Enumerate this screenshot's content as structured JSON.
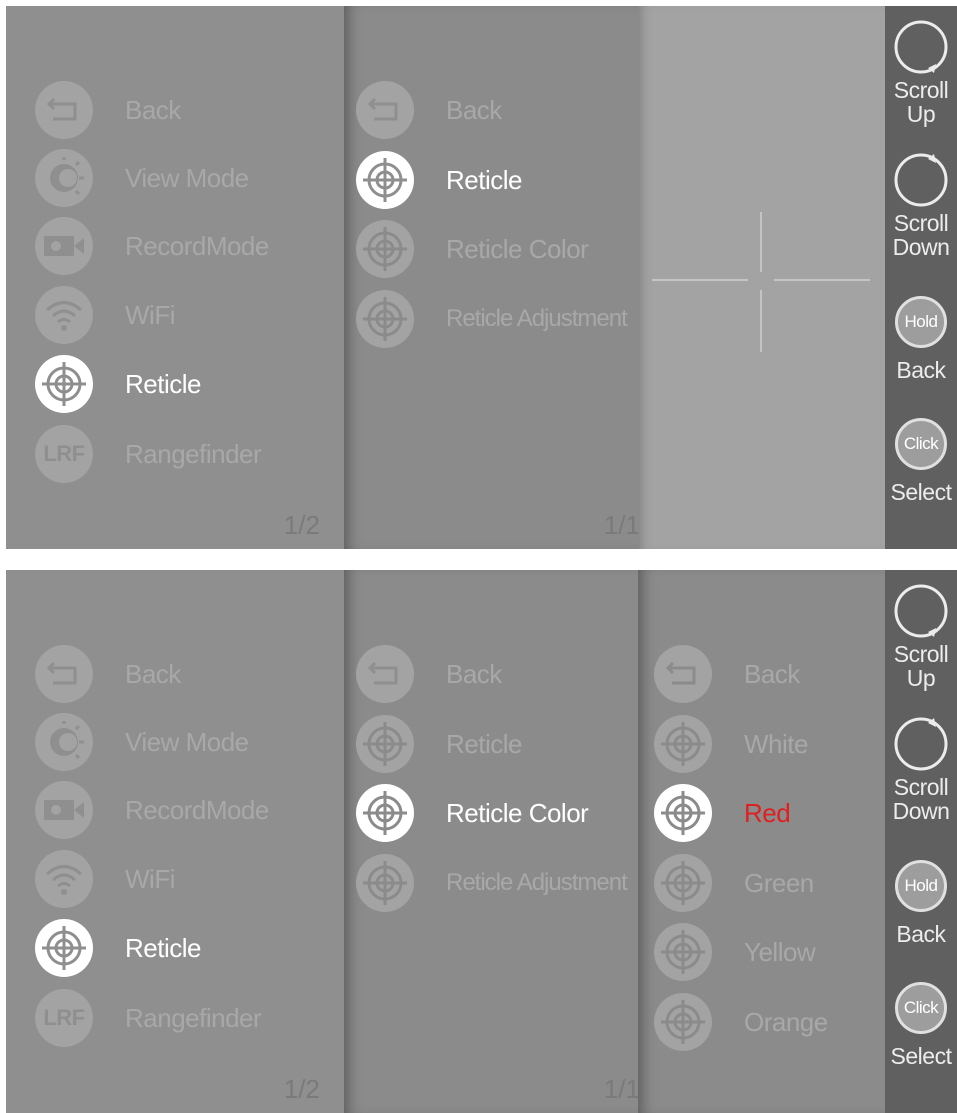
{
  "screen1": {
    "main_menu": {
      "items": [
        {
          "label": "Back",
          "icon": "back-arrow-icon"
        },
        {
          "label": "View Mode",
          "icon": "view-mode-icon"
        },
        {
          "label": "RecordMode",
          "icon": "camera-icon"
        },
        {
          "label": "WiFi",
          "icon": "wifi-icon"
        },
        {
          "label": "Reticle",
          "icon": "reticle-icon",
          "selected": true
        },
        {
          "label": "Rangefinder",
          "icon": "lrf-icon",
          "icon_text": "LRF"
        }
      ],
      "page": "1/2"
    },
    "reticle_menu": {
      "items": [
        {
          "label": "Back",
          "icon": "back-arrow-icon"
        },
        {
          "label": "Reticle",
          "icon": "reticle-icon",
          "selected": true
        },
        {
          "label": "Reticle Color",
          "icon": "reticle-icon"
        },
        {
          "label": "Reticle Adjustment",
          "icon": "reticle-icon"
        }
      ],
      "page": "1/1"
    }
  },
  "screen2": {
    "main_menu": {
      "items": [
        {
          "label": "Back",
          "icon": "back-arrow-icon"
        },
        {
          "label": "View Mode",
          "icon": "view-mode-icon"
        },
        {
          "label": "RecordMode",
          "icon": "camera-icon"
        },
        {
          "label": "WiFi",
          "icon": "wifi-icon"
        },
        {
          "label": "Reticle",
          "icon": "reticle-icon",
          "selected": true
        },
        {
          "label": "Rangefinder",
          "icon": "lrf-icon",
          "icon_text": "LRF"
        }
      ],
      "page": "1/2"
    },
    "reticle_menu": {
      "items": [
        {
          "label": "Back",
          "icon": "back-arrow-icon"
        },
        {
          "label": "Reticle",
          "icon": "reticle-icon"
        },
        {
          "label": "Reticle Color",
          "icon": "reticle-icon",
          "selected": true
        },
        {
          "label": "Reticle Adjustment",
          "icon": "reticle-icon"
        }
      ],
      "page": "1/1"
    },
    "color_menu": {
      "items": [
        {
          "label": "Back",
          "icon": "back-arrow-icon"
        },
        {
          "label": "White",
          "icon": "reticle-icon"
        },
        {
          "label": "Red",
          "icon": "reticle-icon",
          "selected": true
        },
        {
          "label": "Green",
          "icon": "reticle-icon"
        },
        {
          "label": "Yellow",
          "icon": "reticle-icon"
        },
        {
          "label": "Orange",
          "icon": "reticle-icon"
        }
      ]
    }
  },
  "sidebar": {
    "scroll_up": {
      "line1": "Scroll",
      "line2": "Up"
    },
    "scroll_down": {
      "line1": "Scroll",
      "line2": "Down"
    },
    "hold_back": {
      "badge": "Hold",
      "label": "Back"
    },
    "click_select": {
      "badge": "Click",
      "label": "Select"
    }
  },
  "colors": {
    "selected_text": "#ffffff",
    "red_highlight": "#e02020",
    "inactive_text": "#a8a8a8",
    "sidebar_bg": "#606060"
  }
}
